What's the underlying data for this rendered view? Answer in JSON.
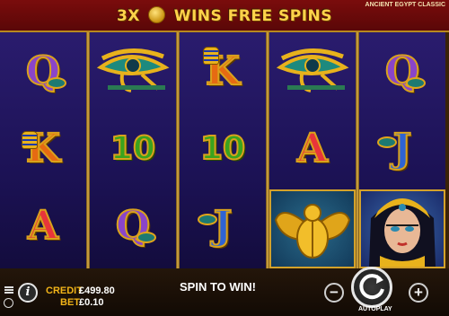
{
  "banner": {
    "multiplier": "3X",
    "text": "WINS FREE SPINS"
  },
  "game_title": "ANCIENT EGYPT CLASSIC",
  "reels": [
    [
      "Q",
      "K",
      "A"
    ],
    [
      "eye-of-horus",
      "10",
      "Q"
    ],
    [
      "K",
      "10",
      "J"
    ],
    [
      "eye-of-horus",
      "A",
      "scarab"
    ],
    [
      "Q",
      "J",
      "cleopatra"
    ]
  ],
  "credit": {
    "label": "CREDIT",
    "value": "£499.80"
  },
  "bet": {
    "label": "BET",
    "value": "£0.10"
  },
  "message": "SPIN TO WIN!",
  "controls": {
    "minus": "−",
    "plus": "+",
    "autoplay_label": "AUTOPLAY"
  },
  "colors": {
    "banner": "#7a0c0c",
    "banner_text": "#ffd34a",
    "reel_bg": "#1c1255",
    "frame": "#d4a22a"
  }
}
